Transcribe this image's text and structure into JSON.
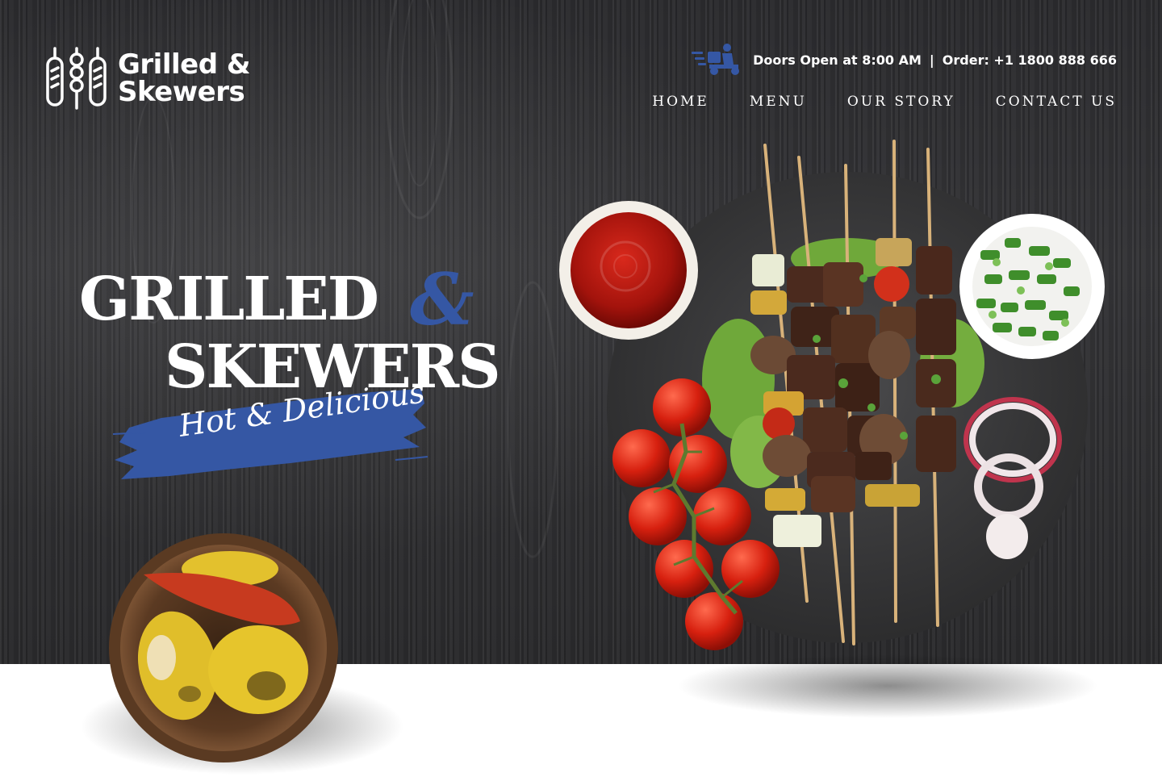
{
  "brand": {
    "name_line1": "Grilled &",
    "name_line2": "Skewers"
  },
  "header": {
    "doors_open": "Doors Open at 8:00 AM",
    "separator": "|",
    "order": "Order: +1 1800 888 666",
    "nav": [
      "HOME",
      "MENU",
      "OUR STORY",
      "CONTACT US"
    ]
  },
  "hero": {
    "title_line1": "GRILLED",
    "title_amp": "&",
    "title_line2": "SKEWERS",
    "tagline": "Hot & Delicious"
  },
  "colors": {
    "accent": "#3557a4",
    "background_dark": "#2e2e30",
    "text": "#ffffff"
  },
  "icons": {
    "logo": "skewers-logo-icon",
    "delivery": "delivery-scooter-icon"
  }
}
